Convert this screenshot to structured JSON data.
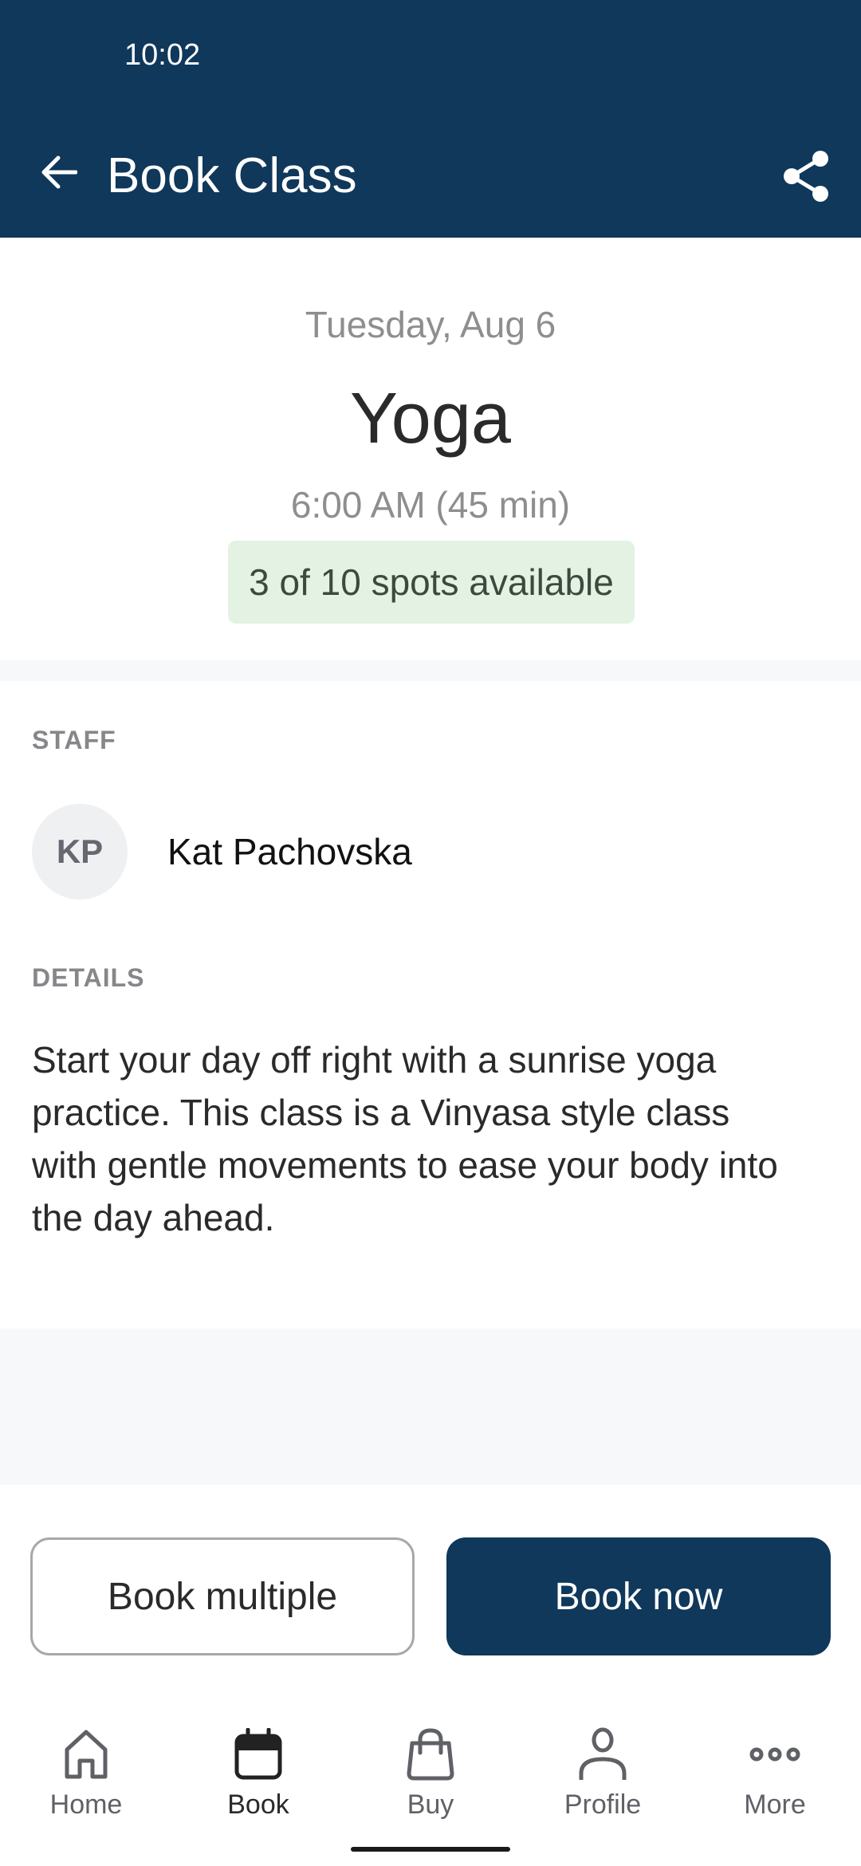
{
  "status_bar": {
    "time": "10:02"
  },
  "app_bar": {
    "title": "Book Class",
    "back_icon": "arrow-left-icon",
    "share_icon": "share-icon"
  },
  "class": {
    "date": "Tuesday, Aug 6",
    "name": "Yoga",
    "time": "6:00 AM (45 min)",
    "availability": "3 of 10 spots available",
    "spots_open": 3,
    "spots_total": 10
  },
  "staff": {
    "section_label": "STAFF",
    "initials": "KP",
    "name": "Kat Pachovska"
  },
  "details": {
    "section_label": "DETAILS",
    "text": "Start your day off right with a sunrise yoga practice. This class is a Vinyasa style class with gentle movements to ease your body into the day ahead."
  },
  "actions": {
    "book_multiple": "Book multiple",
    "book_now": "Book now"
  },
  "tabs": [
    {
      "label": "Home",
      "icon": "home-icon",
      "active": false
    },
    {
      "label": "Book",
      "icon": "calendar-icon",
      "active": true
    },
    {
      "label": "Buy",
      "icon": "shopping-bag-icon",
      "active": false
    },
    {
      "label": "Profile",
      "icon": "person-icon",
      "active": false
    },
    {
      "label": "More",
      "icon": "more-dots-icon",
      "active": false
    }
  ],
  "colors": {
    "brand": "#0f385b",
    "availability_bg": "#e3f2e3"
  }
}
